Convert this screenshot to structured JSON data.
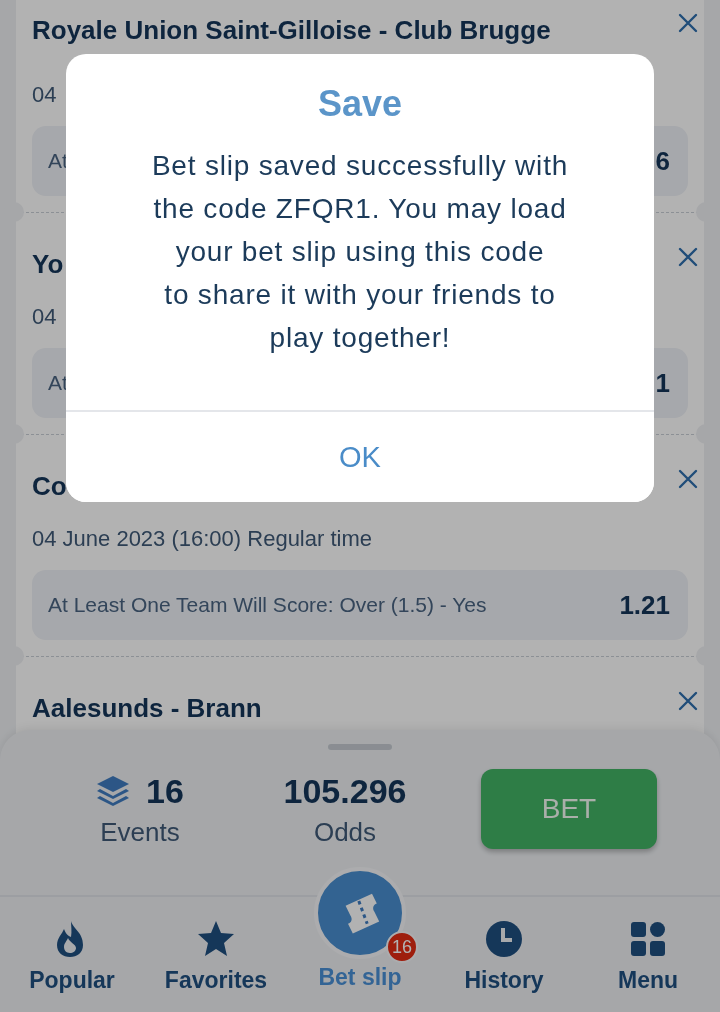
{
  "events": [
    {
      "title": "Royale Union Saint-Gilloise - Club Brugge",
      "date": "04",
      "selection": "At",
      "odds": "6"
    },
    {
      "title": "Yo",
      "date": "04",
      "selection": "At",
      "odds": "1"
    },
    {
      "title": "Co",
      "date": "04 June 2023 (16:00) Regular time",
      "selection": "At Least One Team Will Score: Over (1.5) - Yes",
      "odds": "1.21"
    },
    {
      "title": "Aalesunds - Brann"
    }
  ],
  "summary": {
    "events_count": "16",
    "events_label": "Events",
    "odds": "105.296",
    "odds_label": "Odds",
    "bet_button": "BET"
  },
  "nav": [
    {
      "kind": "flame",
      "label": "Popular",
      "selected": false
    },
    {
      "kind": "star",
      "label": "Favorites",
      "selected": false
    },
    {
      "kind": "ticket",
      "label": "Bet slip",
      "selected": true,
      "badge": "16"
    },
    {
      "kind": "clock",
      "label": "History",
      "selected": false
    },
    {
      "kind": "grid",
      "label": "Menu",
      "selected": false
    }
  ],
  "dialog": {
    "title": "Save",
    "message": "Bet slip saved successfully with\nthe code ZFQR1. You may load\nyour bet slip using this code\nto share it with your friends to\nplay together!",
    "button": "OK"
  }
}
